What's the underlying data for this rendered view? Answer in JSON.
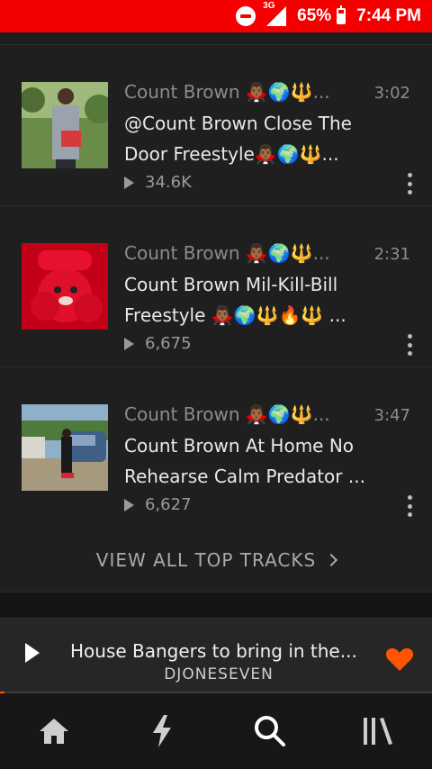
{
  "status_bar": {
    "network": "3G",
    "battery": "65%",
    "time": "7:44 PM"
  },
  "tracks": [
    {
      "artist": "Count Brown 🧛🏾‍♂️🌍🔱...",
      "title": "@Count Brown Close The Door Freestyle🧛🏾‍♂️🌍🔱...",
      "duration": "3:02",
      "plays": "34.6K"
    },
    {
      "artist": "Count Brown 🧛🏾‍♂️🌍🔱...",
      "title": "Count Brown Mil-Kill-Bill Freestyle 🧛🏾‍♂️🌍🔱🔥🔱 ...",
      "duration": "2:31",
      "plays": "6,675"
    },
    {
      "artist": "Count Brown 🧛🏾‍♂️🌍🔱...",
      "title": "Count Brown At Home No Rehearse Calm Predator ...",
      "duration": "3:47",
      "plays": "6,627"
    }
  ],
  "view_all": {
    "label": "VIEW ALL TOP TRACKS"
  },
  "mini_player": {
    "title": "House Bangers to bring in the...",
    "subtitle": "DJONESEVEN",
    "progress": 0.01,
    "heart_color": "#ff5500"
  },
  "nav": [
    {
      "icon": "home-icon"
    },
    {
      "icon": "stream-icon"
    },
    {
      "icon": "search-icon"
    },
    {
      "icon": "library-icon"
    }
  ]
}
